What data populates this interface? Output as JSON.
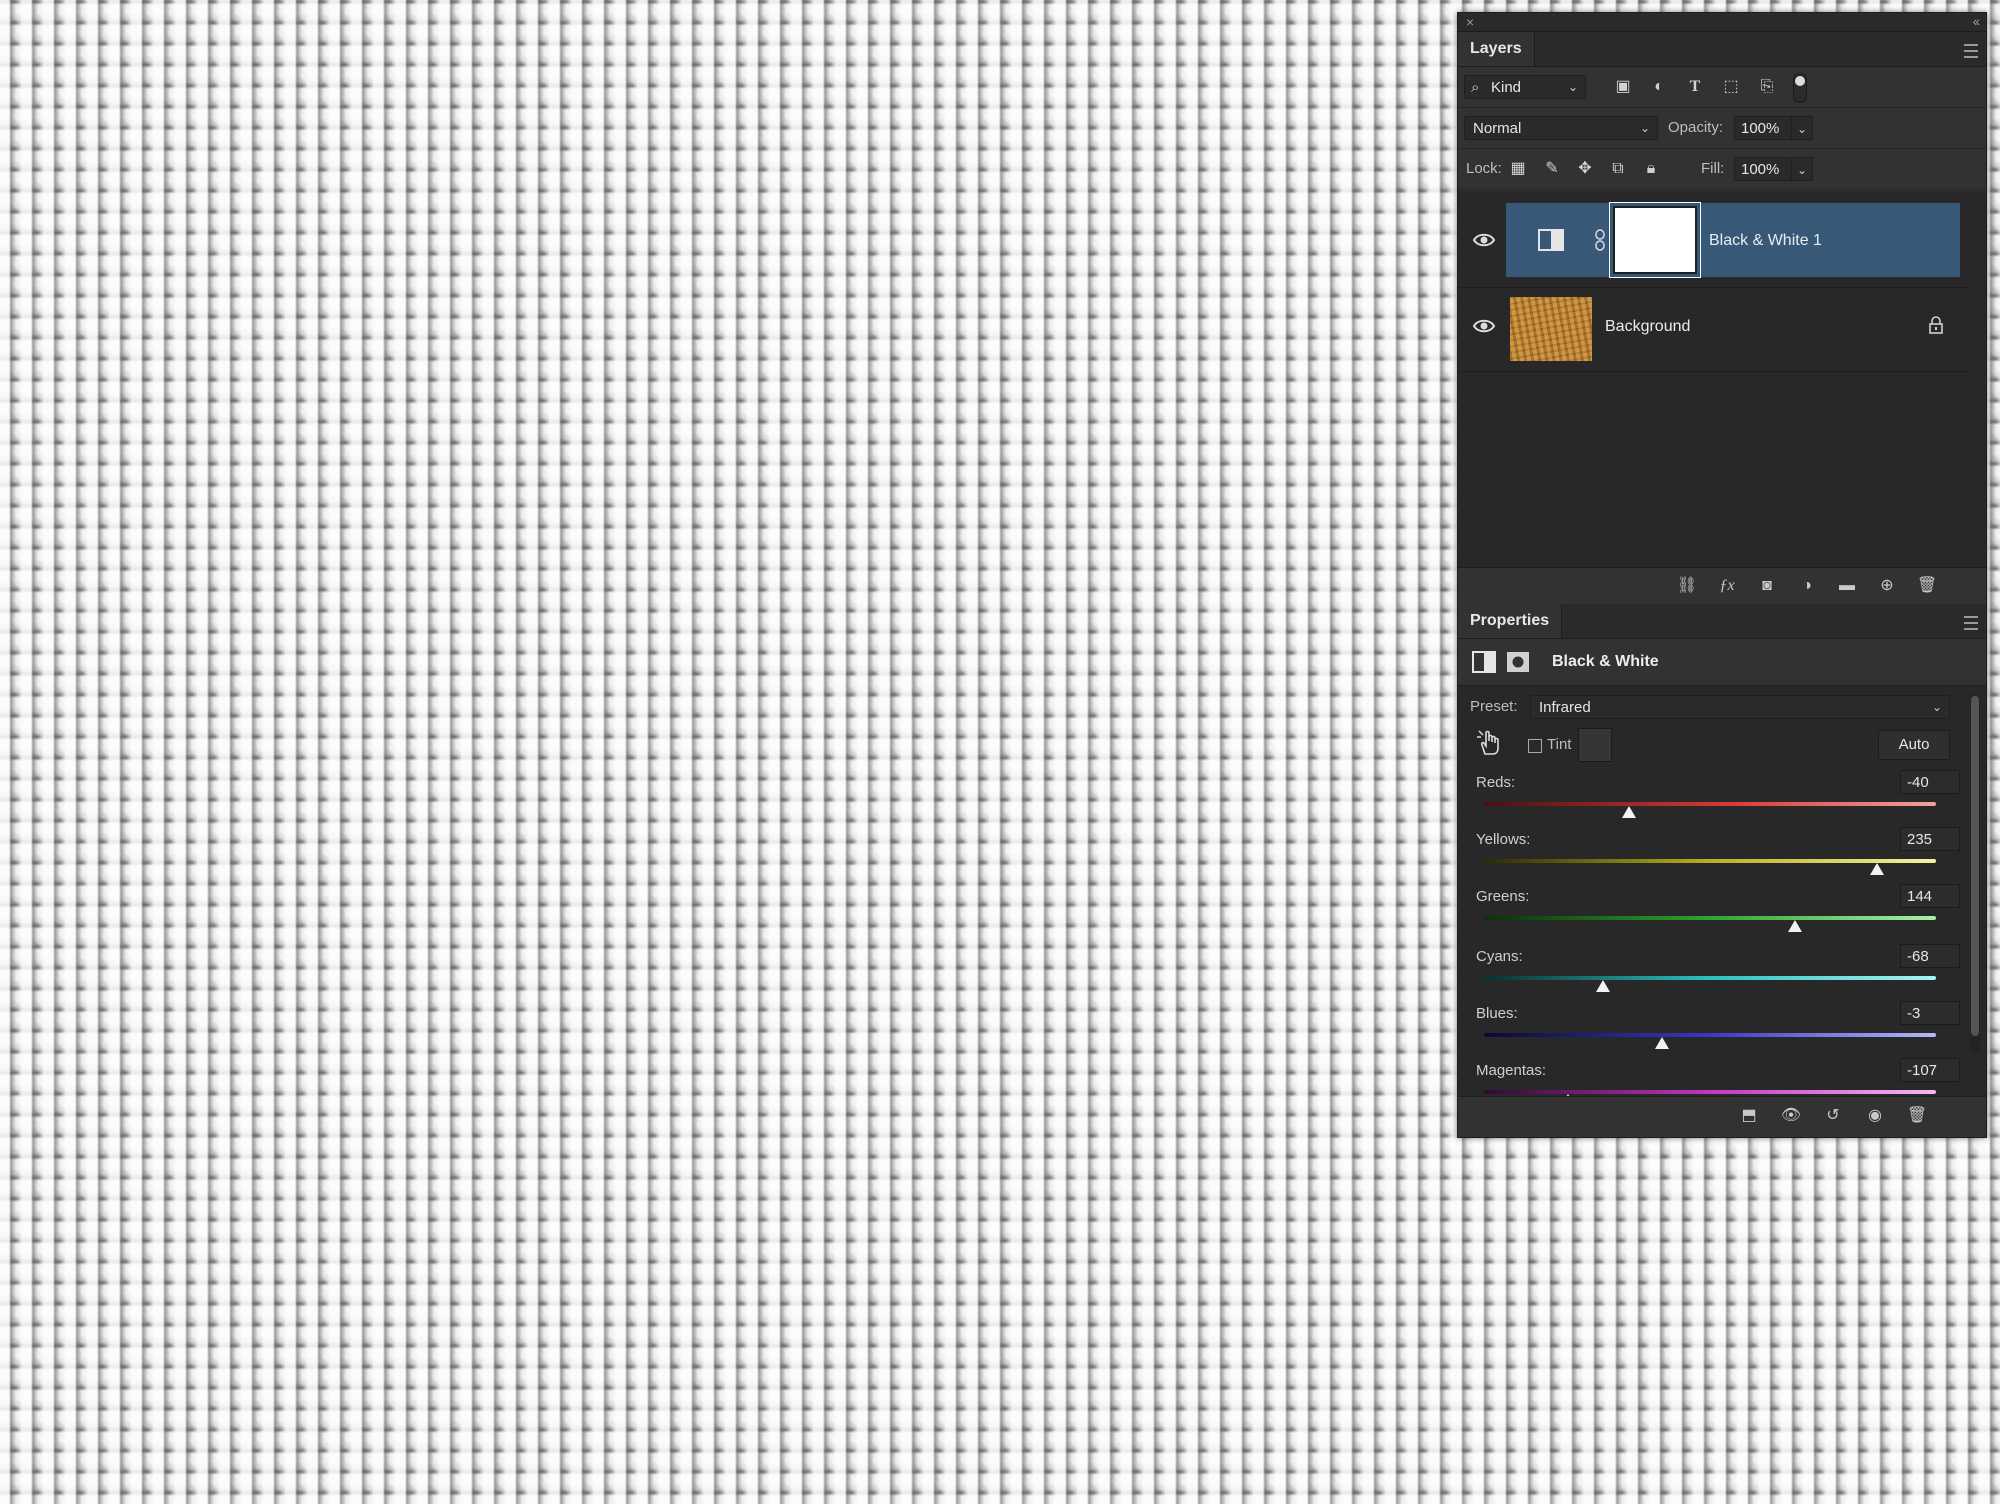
{
  "layers_panel": {
    "tab_title": "Layers",
    "filter_kind": "Kind",
    "blend_mode": "Normal",
    "opacity_label": "Opacity:",
    "opacity_value": "100%",
    "lock_label": "Lock:",
    "fill_label": "Fill:",
    "fill_value": "100%",
    "layers": [
      {
        "name": "Black & White 1",
        "selected": true,
        "visible": true
      },
      {
        "name": "Background",
        "selected": false,
        "visible": true,
        "locked": true
      }
    ]
  },
  "properties_panel": {
    "tab_title": "Properties",
    "adjustment_name": "Black & White",
    "preset_label": "Preset:",
    "preset_value": "Infrared",
    "tint_label": "Tint",
    "tint_checked": false,
    "auto_label": "Auto",
    "sliders": [
      {
        "label": "Reds:",
        "value": "-40",
        "min": -200,
        "max": 300
      },
      {
        "label": "Yellows:",
        "value": "235",
        "min": -200,
        "max": 300
      },
      {
        "label": "Greens:",
        "value": "144",
        "min": -200,
        "max": 300
      },
      {
        "label": "Cyans:",
        "value": "-68",
        "min": -200,
        "max": 300
      },
      {
        "label": "Blues:",
        "value": "-3",
        "min": -200,
        "max": 300
      },
      {
        "label": "Magentas:",
        "value": "-107",
        "min": -200,
        "max": 300
      }
    ]
  },
  "colors": {
    "panel_bg": "#323232",
    "selection": "#385878",
    "reds_track": "#d93a3a",
    "yellows_track": "#e6e046",
    "greens_track": "#3fbf3f",
    "cyans_track": "#3fd8d8",
    "blues_track": "#4a4ae0",
    "magentas_track": "#d84ad8"
  }
}
